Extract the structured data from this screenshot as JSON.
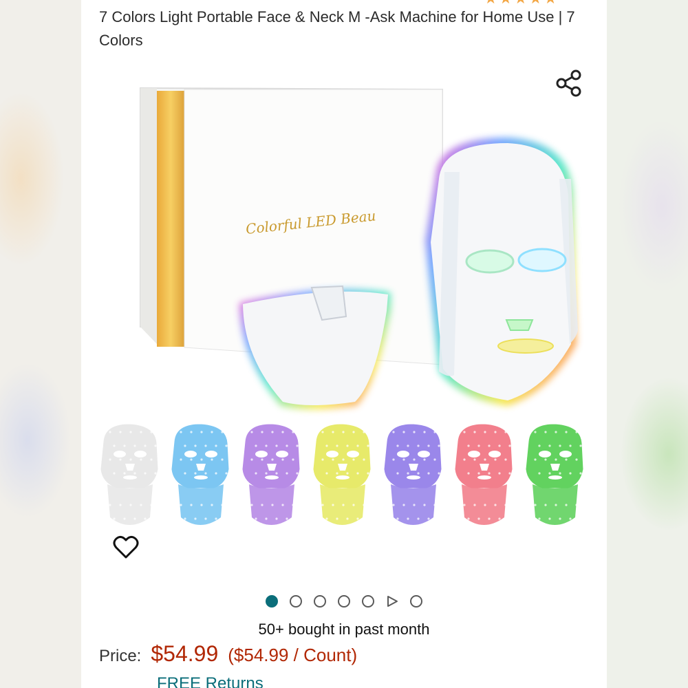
{
  "product": {
    "title": "7 Colors Light Portable Face & Neck M -Ask Machine for Home Use | 7 Colors",
    "box_text": "Colorful  LED  Beau"
  },
  "rating": {
    "stars_display": "★★★★★"
  },
  "gallery": {
    "dots_total": 7,
    "active_index": 0,
    "thumbnail_colors": [
      "#e8e8e8",
      "#7cc6f2",
      "#b78be6",
      "#e7ea6a",
      "#9a87ea",
      "#f27f8c",
      "#62d25f"
    ]
  },
  "social": {
    "bought_text": "50+ bought in past month"
  },
  "pricing": {
    "label": "Price:",
    "value": "$54.99",
    "unit_price": "($54.99 / Count)"
  },
  "shipping": {
    "returns": "FREE Returns"
  },
  "icons": {
    "share": "share-icon",
    "wishlist": "heart-icon",
    "video": "play-icon"
  },
  "colors": {
    "price": "#b12704",
    "link": "#0b6e7a",
    "active_dot": "#0b6e7a",
    "stars": "#f3a847"
  }
}
